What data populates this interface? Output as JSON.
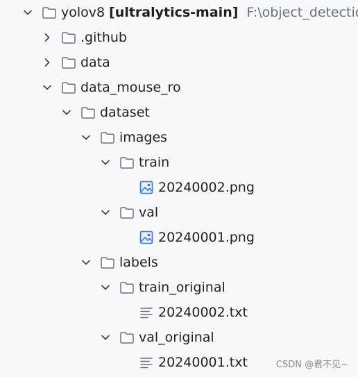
{
  "tree": [
    {
      "level": 0,
      "expanded": true,
      "type": "folder",
      "label": "yolov8",
      "module": "[ultralytics-main]",
      "path": "F:\\object_detection\\yo"
    },
    {
      "level": 1,
      "expanded": false,
      "type": "folder",
      "label": ".github"
    },
    {
      "level": 1,
      "expanded": false,
      "type": "folder",
      "label": "data"
    },
    {
      "level": 1,
      "expanded": true,
      "type": "folder",
      "label": "data_mouse_ro"
    },
    {
      "level": 2,
      "expanded": true,
      "type": "folder",
      "label": "dataset"
    },
    {
      "level": 3,
      "expanded": true,
      "type": "folder",
      "label": "images"
    },
    {
      "level": 4,
      "expanded": true,
      "type": "folder",
      "label": "train"
    },
    {
      "level": 5,
      "type": "image-file",
      "label": "20240002.png"
    },
    {
      "level": 4,
      "expanded": true,
      "type": "folder",
      "label": "val"
    },
    {
      "level": 5,
      "type": "image-file",
      "label": "20240001.png"
    },
    {
      "level": 3,
      "expanded": true,
      "type": "folder",
      "label": "labels"
    },
    {
      "level": 4,
      "expanded": true,
      "type": "folder",
      "label": "train_original"
    },
    {
      "level": 5,
      "type": "text-file",
      "label": "20240002.txt"
    },
    {
      "level": 4,
      "expanded": true,
      "type": "folder",
      "label": "val_original"
    },
    {
      "level": 5,
      "type": "text-file",
      "label": "20240001.txt"
    }
  ],
  "watermark": "CSDN @君不见~",
  "colors": {
    "chevron": "#3d3f45",
    "folder_stroke": "#6c707e",
    "image_icon": "#3574f0",
    "text_icon": "#6c707e",
    "project_path": "#6c707e"
  }
}
